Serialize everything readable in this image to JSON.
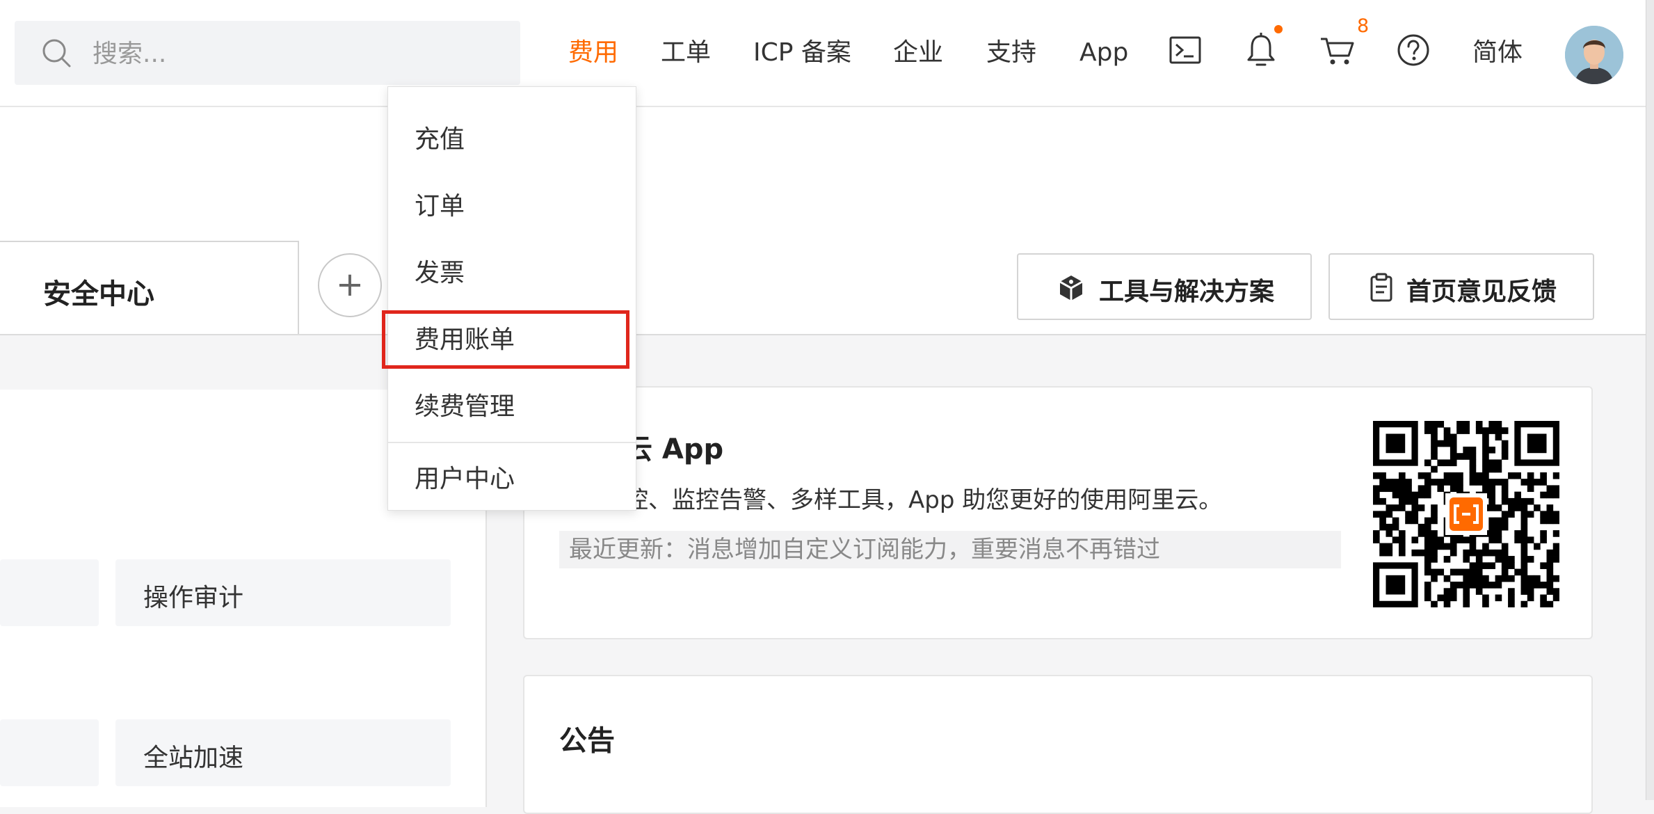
{
  "topbar": {
    "search_placeholder": "搜索...",
    "nav": [
      "费用",
      "工单",
      "ICP 备案",
      "企业",
      "支持",
      "App"
    ],
    "cart_count": "8",
    "language": "简体",
    "accent_color": "#ff6a00"
  },
  "dropdown": {
    "items": [
      "充值",
      "订单",
      "发票",
      "费用账单",
      "续费管理"
    ],
    "footer_item": "用户中心"
  },
  "header": {
    "tab_label": "安全中心",
    "add_tab_symbol": "+",
    "tools_button": "工具与解决方案",
    "feedback_button": "首页意见反馈"
  },
  "left_panel": {
    "cells": [
      "操作审计",
      "全站加速"
    ]
  },
  "app_card": {
    "title": "云 App",
    "description": "控、监控告警、多样工具，App 助您更好的使用阿里云。",
    "update": "最近更新：消息增加自定义订阅能力，重要消息不再错过"
  },
  "notice": {
    "title": "公告"
  },
  "icons": [
    "search-icon",
    "terminal-icon",
    "bell-icon",
    "cart-icon",
    "help-icon",
    "cube-icon",
    "clipboard-icon",
    "qr-code"
  ]
}
